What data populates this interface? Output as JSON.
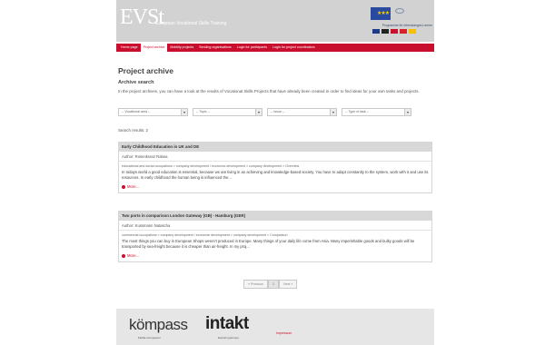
{
  "header": {
    "logo": "EVSt",
    "tagline": "European Vocational Skills Training",
    "eu_flag": "eu-flag-icon",
    "programme_text": "Programme für lebenslanges Lernen",
    "flags": [
      "#1f3a8a",
      "#222222",
      "#c8102e",
      "#d9202a",
      "#f4c000"
    ]
  },
  "nav": {
    "items": [
      "Home page",
      "Project archive",
      "Mobility projects",
      "Sending organisations",
      "Login for participants",
      "Login for project coordinators"
    ],
    "active": "Project archive",
    "accent": "#c8102e"
  },
  "main": {
    "title": "Project archive",
    "subtitle": "Archive search",
    "intro": "In the project archives, you can have a look at the results of Vocational Skills Projects that have already been created in order to find ideas for your own tasks and projects.",
    "filters": [
      "-- Vocational area --",
      "-- Topic --",
      "-- Issue --",
      "-- Type of task --"
    ],
    "results_label": "Search results: 2",
    "results": [
      {
        "title": "Early Childhood Education in UK and DE",
        "author": "Author: Rosenkranz Rabea",
        "path": "educational and social occupations > company development / economic development > company development > Overview",
        "text": "In todays world a good education is essential, because we are living in an achieving and knowledge-based society. You have to adapt constantly to the system, work with it and use its resources. In early childhood the human being is influenced the...",
        "more": "More..."
      },
      {
        "title": "Two ports in comparison London Gateway (GB) - Hamburg (GER)",
        "author": "Author: Kussmann Natascha",
        "path": "commercial occupations > company development / economic development > company development > Comparison",
        "text": "The most things you can buy in European Shops weren't produced in Europe. Many things of your daily life come from Asia. Many imperishable goods and bulky goods will be transported by sea-freight because it is cheaper than air-freight. In my proj...",
        "more": "More..."
      }
    ],
    "pager": {
      "previous": "« Previous",
      "current": "1",
      "next": "Next »"
    }
  },
  "footer": {
    "logo1": "kömpass",
    "logo1_sub": "Mobile Kompetenz",
    "logo2": "intakt",
    "logo2_sub": "Exploring Europe",
    "link": "Impressum"
  }
}
